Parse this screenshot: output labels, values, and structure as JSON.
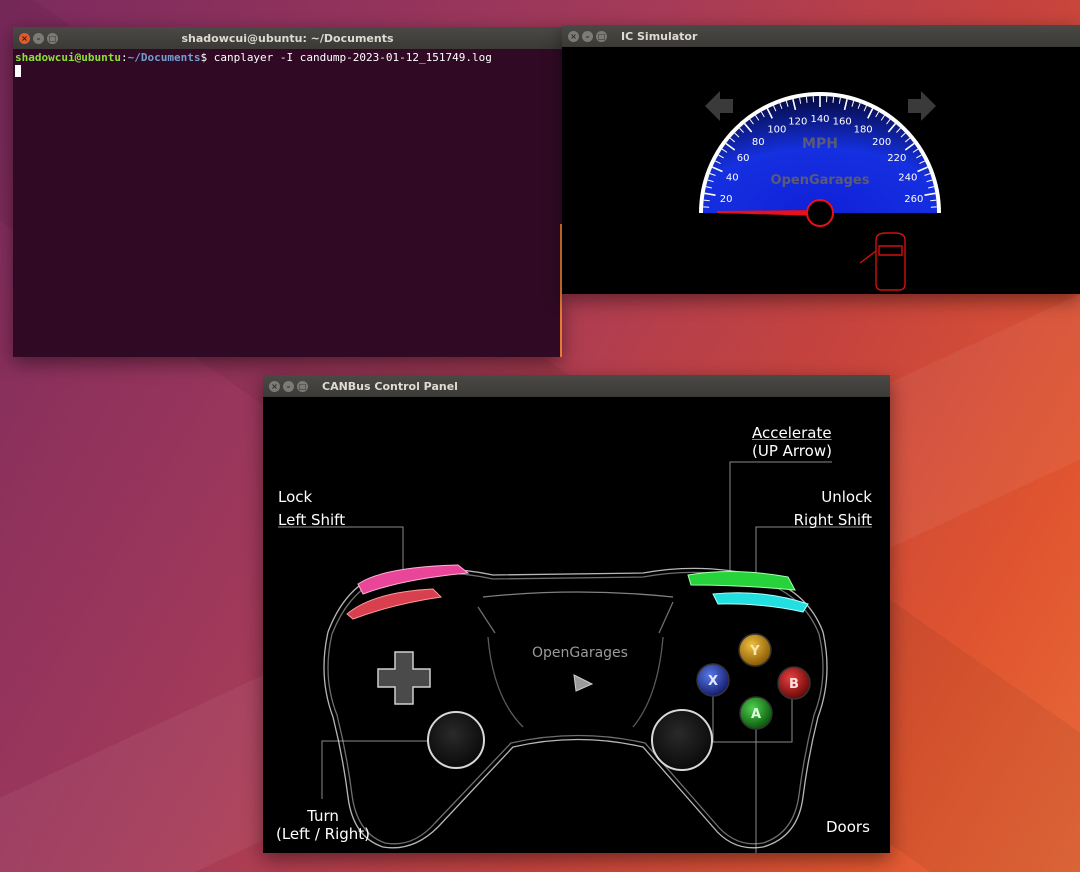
{
  "terminal": {
    "title": "shadowcui@ubuntu: ~/Documents",
    "prompt_user": "shadowcui@ubuntu",
    "prompt_sep": ":",
    "prompt_path": "~/Documents",
    "prompt_symbol": "$",
    "command": " canplayer -I candump-2023-01-12_151749.log"
  },
  "ic_simulator": {
    "title": "IC Simulator",
    "speed_unit": "MPH",
    "brand": "OpenGarages",
    "speed_ticks": [
      "20",
      "40",
      "60",
      "80",
      "100",
      "120",
      "140",
      "160",
      "180",
      "200",
      "220",
      "240",
      "260"
    ],
    "speed_value": 0
  },
  "control_panel": {
    "title": "CANBus Control Panel",
    "brand": "OpenGarages",
    "accelerate_line1": "Accelerate",
    "accelerate_line2": "(UP Arrow)",
    "lock_line1": "Lock",
    "lock_line2": "Left Shift",
    "unlock_line1": "Unlock",
    "unlock_line2": "Right Shift",
    "turn_line1": "Turn",
    "turn_line2": "(Left / Right)",
    "doors": "Doors",
    "button_y": "Y",
    "button_x": "X",
    "button_b": "B",
    "button_a": "A"
  },
  "window_controls": {
    "close": "×",
    "minimize": "–",
    "maximize": "□"
  },
  "colors": {
    "terminal_bg": "#300a24",
    "prompt_user": "#8ae234",
    "prompt_path": "#729fcf",
    "gauge_blue": "#1d2ee8",
    "needle_red": "#e8101a",
    "lock_pink": "#e9469a",
    "unlock_cyan": "#22e0e0",
    "accelerate_green": "#27d33a"
  }
}
